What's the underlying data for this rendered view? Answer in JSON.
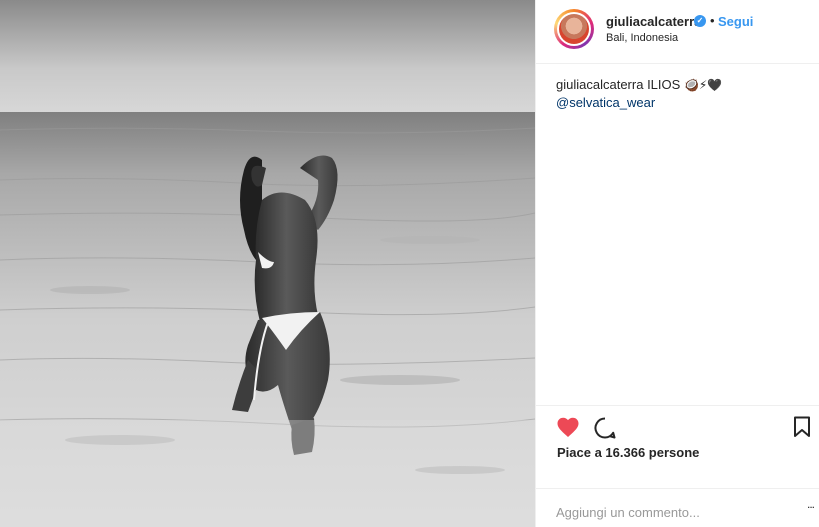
{
  "post": {
    "username": "giuliacalcaterra",
    "verified_mark": "✓",
    "separator": "•",
    "follow_label": "Segui",
    "location": "Bali, Indonesia",
    "caption_user": "giuliacalcaterra",
    "caption_text": "ILIOS",
    "caption_emojis": "🥥⚡🖤",
    "caption_mention": "@selvatica_wear",
    "likes_text": "Piace a 16.366 persone",
    "comment_placeholder": "Aggiungi un commento...",
    "more_label": "..."
  },
  "icons": {
    "like": "heart-icon",
    "comment": "speech-bubble-icon",
    "save": "bookmark-icon",
    "verified": "verified-badge-icon"
  },
  "colors": {
    "like_red": "#ed4956",
    "link_blue": "#3897f0",
    "mention_blue": "#003569",
    "text": "#262626",
    "divider": "#efefef"
  }
}
